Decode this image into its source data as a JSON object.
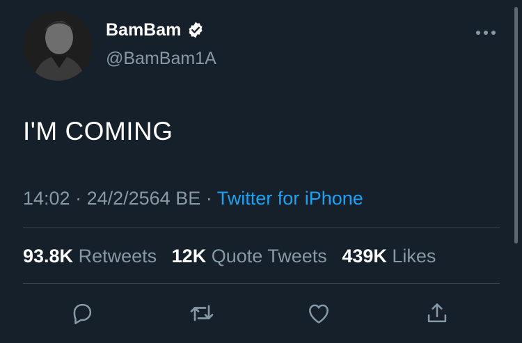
{
  "tweet": {
    "display_name": "BamBam",
    "handle": "@BamBam1A",
    "text": "I'M COMING",
    "time": "14:02",
    "date": "24/2/2564 BE",
    "separator": " · ",
    "source": "Twitter for iPhone",
    "verified": true
  },
  "stats": {
    "retweets_count": "93.8K",
    "retweets_label": "Retweets",
    "quotes_count": "12K",
    "quotes_label": "Quote Tweets",
    "likes_count": "439K",
    "likes_label": "Likes"
  },
  "actions": {
    "reply_icon": "reply-icon",
    "retweet_icon": "retweet-icon",
    "like_icon": "heart-icon",
    "share_icon": "share-icon"
  },
  "colors": {
    "background": "#15202b",
    "secondary_text": "#8899a6",
    "link": "#1da1f2",
    "divider": "#38444d"
  }
}
